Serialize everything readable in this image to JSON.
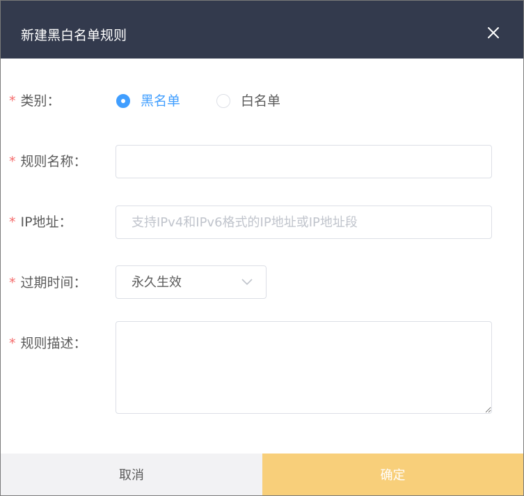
{
  "dialog": {
    "title": "新建黑白名单规则"
  },
  "form": {
    "required_mark": "*",
    "category": {
      "label": "类别：",
      "options": [
        {
          "label": "黑名单",
          "checked": true
        },
        {
          "label": "白名单",
          "checked": false
        }
      ]
    },
    "rule_name": {
      "label": "规则名称：",
      "value": "",
      "placeholder": ""
    },
    "ip_address": {
      "label": "IP地址：",
      "value": "",
      "placeholder": "支持IPv4和IPv6格式的IP地址或IP地址段"
    },
    "expiry": {
      "label": "过期时间：",
      "selected": "永久生效"
    },
    "description": {
      "label": "规则描述：",
      "value": ""
    }
  },
  "footer": {
    "cancel_label": "取消",
    "confirm_label": "确定"
  },
  "colors": {
    "header_bg": "#333a4d",
    "accent": "#409eff",
    "required": "#f56c6c",
    "confirm_bg": "#f8cf7a",
    "cancel_bg": "#f2f2f4"
  }
}
